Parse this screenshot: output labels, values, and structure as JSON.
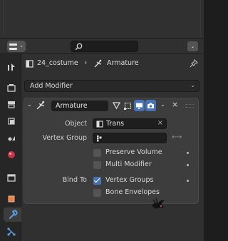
{
  "header": {
    "search_placeholder": ""
  },
  "breadcrumb": {
    "object": "24_costume",
    "modifier": "Armature"
  },
  "add_modifier": {
    "label": "Add Modifier"
  },
  "modifier": {
    "name": "Armature",
    "object_label": "Object",
    "object_value": "Trans",
    "vertex_group_label": "Vertex Group",
    "vertex_group_value": "",
    "preserve_volume": {
      "label": "Preserve Volume",
      "checked": false
    },
    "multi_modifier": {
      "label": "Multi Modifier",
      "checked": false
    },
    "bind_to_label": "Bind To",
    "vertex_groups": {
      "label": "Vertex Groups",
      "checked": true
    },
    "bone_envelopes": {
      "label": "Bone Envelopes",
      "checked": false
    }
  },
  "colors": {
    "accent": "#4772b3",
    "panel": "#3d3d3d",
    "background": "#303030"
  },
  "icons": [
    "editor-type-icon",
    "search-icon",
    "tool-icon",
    "render-icon",
    "output-icon",
    "view-layer-icon",
    "scene-icon",
    "world-icon",
    "collection-icon",
    "object-icon",
    "modifier-wrench-icon",
    "particles-icon",
    "armature-icon",
    "pin-icon"
  ]
}
